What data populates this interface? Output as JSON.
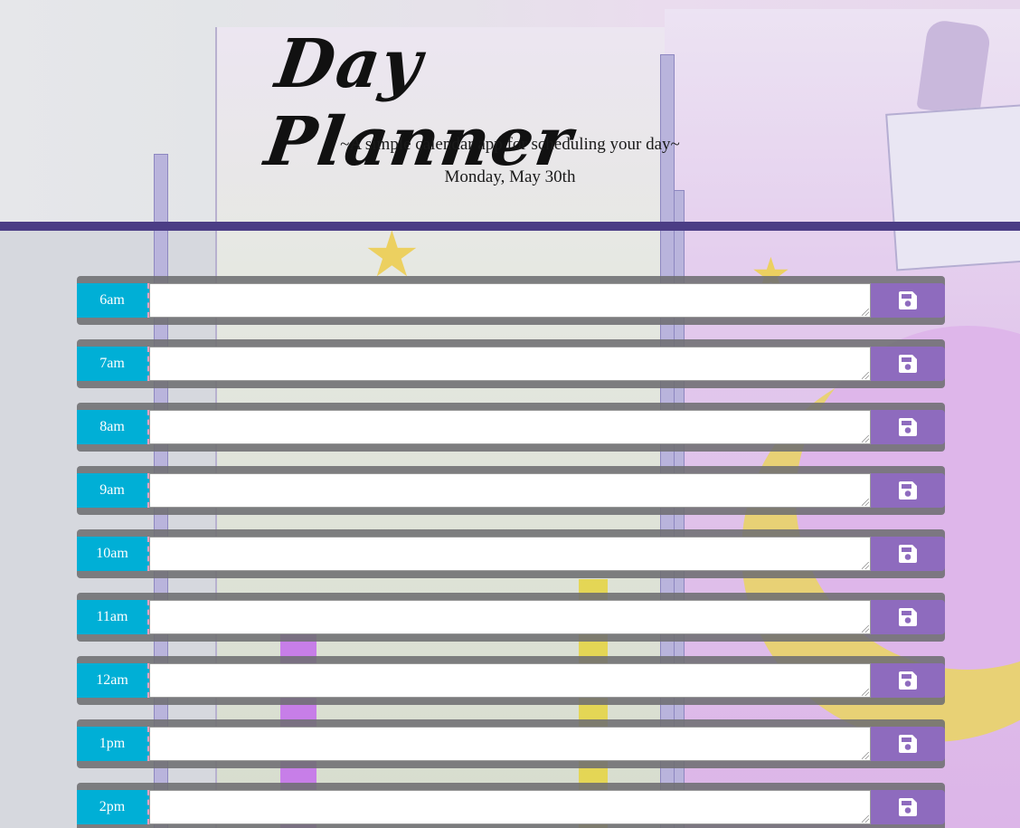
{
  "header": {
    "title": "Day Planner",
    "subtitle": "~A simple calendar app for scheduling your day~",
    "current_day": "Monday, May 30th"
  },
  "time_blocks": [
    {
      "hour": "6am",
      "description": ""
    },
    {
      "hour": "7am",
      "description": ""
    },
    {
      "hour": "8am",
      "description": ""
    },
    {
      "hour": "9am",
      "description": ""
    },
    {
      "hour": "10am",
      "description": ""
    },
    {
      "hour": "11am",
      "description": ""
    },
    {
      "hour": "12am",
      "description": ""
    },
    {
      "hour": "1pm",
      "description": ""
    },
    {
      "hour": "2pm",
      "description": ""
    }
  ],
  "save_icon": "floppy-disk-icon",
  "colors": {
    "hour_background": "#00afd6",
    "save_button": "#8e6bbe",
    "divider": "#4b3d85",
    "block_frame": "#6e6e72"
  }
}
